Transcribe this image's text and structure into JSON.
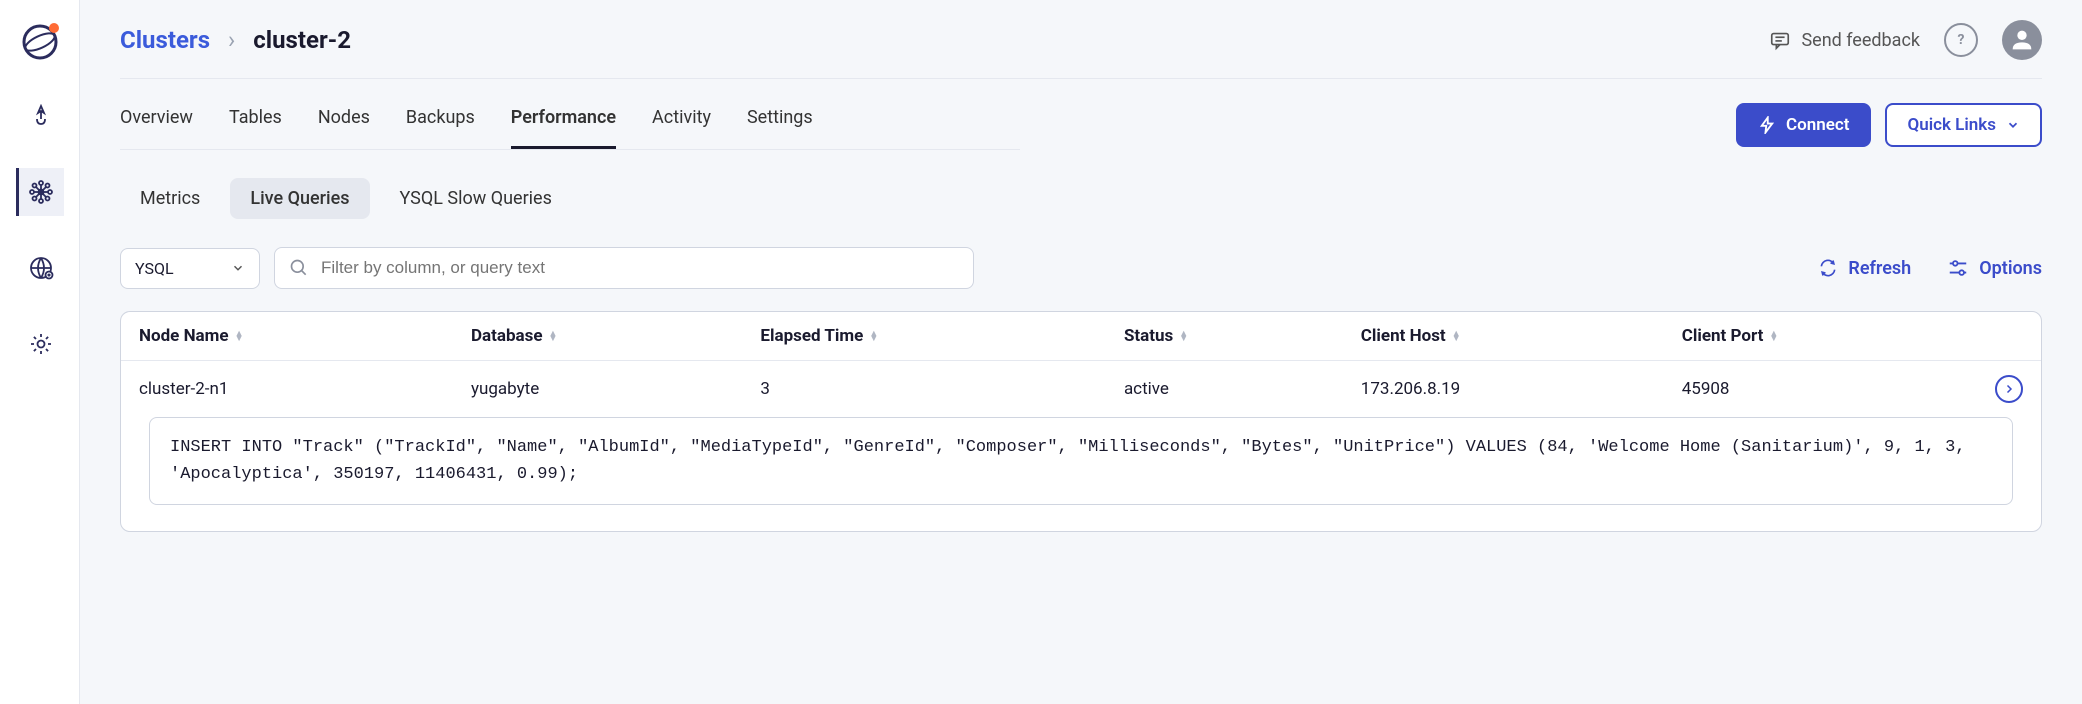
{
  "breadcrumb": {
    "root": "Clusters",
    "leaf": "cluster-2"
  },
  "topbar": {
    "feedback": "Send feedback"
  },
  "tabs": {
    "overview": "Overview",
    "tables": "Tables",
    "nodes": "Nodes",
    "backups": "Backups",
    "performance": "Performance",
    "activity": "Activity",
    "settings": "Settings"
  },
  "actions": {
    "connect": "Connect",
    "quick_links": "Quick Links"
  },
  "subtabs": {
    "metrics": "Metrics",
    "live": "Live Queries",
    "slow": "YSQL Slow Queries"
  },
  "filter": {
    "api": "YSQL",
    "placeholder": "Filter by column, or query text"
  },
  "toolbar": {
    "refresh": "Refresh",
    "options": "Options"
  },
  "table": {
    "headers": {
      "node": "Node Name",
      "db": "Database",
      "elapsed": "Elapsed Time",
      "status": "Status",
      "host": "Client Host",
      "port": "Client Port"
    },
    "row": {
      "node": "cluster-2-n1",
      "db": "yugabyte",
      "elapsed": "3",
      "status": "active",
      "host": "173.206.8.19",
      "port": "45908",
      "query": "INSERT INTO \"Track\" (\"TrackId\", \"Name\", \"AlbumId\", \"MediaTypeId\", \"GenreId\", \"Composer\", \"Milliseconds\", \"Bytes\", \"UnitPrice\") VALUES (84, 'Welcome Home (Sanitarium)', 9, 1, 3, 'Apocalyptica', 350197, 11406431, 0.99);"
    }
  }
}
